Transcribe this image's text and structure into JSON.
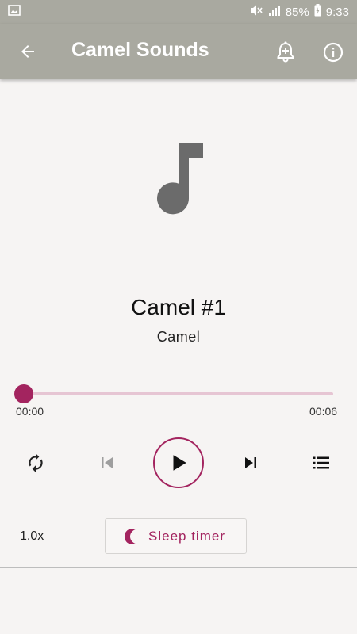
{
  "status_bar": {
    "battery": "85%",
    "time": "9:33",
    "icons": [
      "image-notification-icon",
      "mute-icon",
      "signal-icon",
      "battery-charging-icon"
    ]
  },
  "app_bar": {
    "title": "Camel Sounds",
    "back_icon": "arrow-back-icon",
    "actions": [
      "add-alarm-icon",
      "info-icon"
    ]
  },
  "player": {
    "artwork_icon": "music-note-icon",
    "track_title": "Camel #1",
    "artist": "Camel",
    "progress_fraction": 0,
    "time_current": "00:00",
    "time_total": "00:06",
    "controls": [
      "repeat-icon",
      "skip-previous-icon",
      "play-icon",
      "skip-next-icon",
      "queue-list-icon"
    ],
    "speed": "1.0x",
    "sleep_timer_label": "Sleep timer",
    "sleep_timer_icon": "moon-icon"
  },
  "colors": {
    "accent": "#a3245f",
    "accent_light": "#e6c5d3",
    "appbar": "#a9a9a0",
    "background": "#f6f4f3",
    "artwork": "#6b6b6b"
  }
}
